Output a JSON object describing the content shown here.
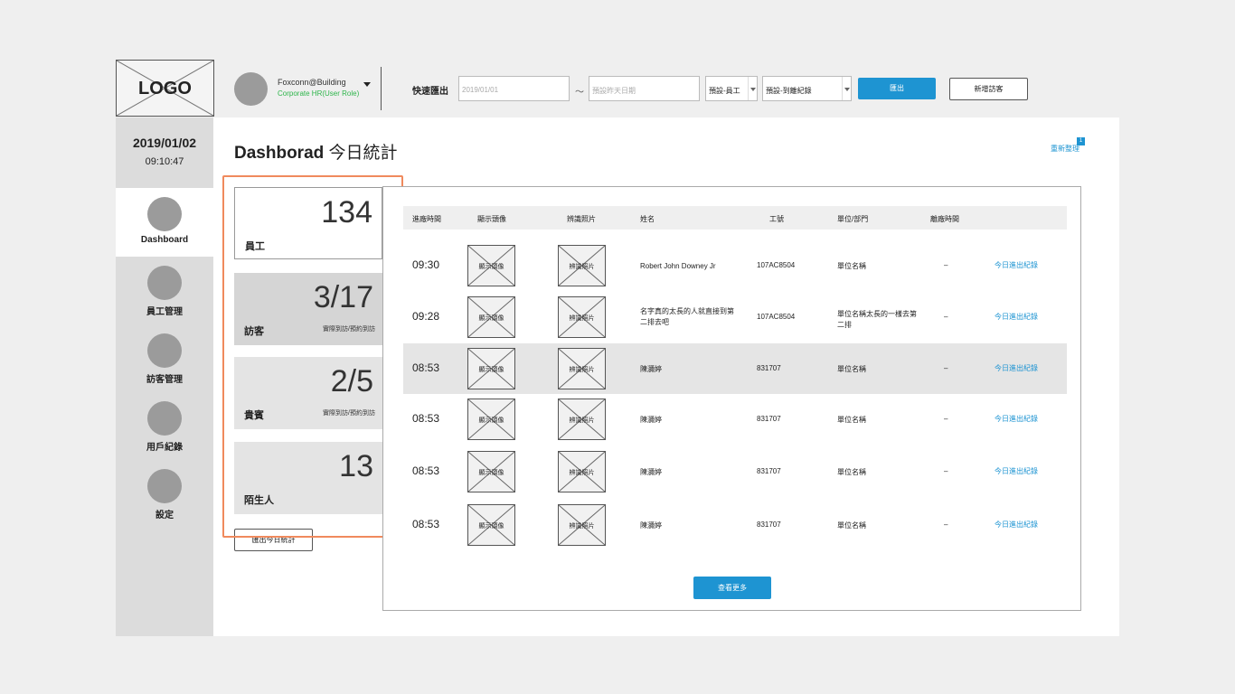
{
  "logo": {
    "text": "LOGO"
  },
  "user": {
    "name": "Foxconn@Building",
    "role": "Corporate HR(User Role)"
  },
  "quick_export": {
    "label": "快速匯出",
    "date_from": "2019/01/01",
    "separator": "～",
    "date_to_placeholder": "預設昨天日期",
    "type_select": "預設-員工",
    "record_select": "預設-到離紀錄",
    "export_button": "匯出"
  },
  "add_visitor_button": "新增訪客",
  "clock": {
    "date": "2019/01/02",
    "time": "09:10:47"
  },
  "sidebar": {
    "items": [
      {
        "label": "Dashboard",
        "active": true
      },
      {
        "label": "員工管理"
      },
      {
        "label": "訪客管理"
      },
      {
        "label": "用戶紀錄"
      },
      {
        "label": "設定"
      }
    ]
  },
  "page": {
    "title_en": "Dashborad",
    "title_zh": "今日統計",
    "refresh_link": "重新整理",
    "refresh_badge": "1"
  },
  "stats": {
    "staff": {
      "value": "134",
      "label": "員工"
    },
    "visitor": {
      "value": "3/17",
      "label": "訪客",
      "sub": "實際到訪/預約到訪"
    },
    "vip": {
      "value": "2/5",
      "label": "貴賓",
      "sub": "實際到訪/預約到訪"
    },
    "stranger": {
      "value": "13",
      "label": "陌生人"
    },
    "export_button": "匯出今日統計"
  },
  "table": {
    "headers": [
      "進廠時間",
      "顯示頭像",
      "辨識照片",
      "姓名",
      "工號",
      "單位/部門",
      "離廠時間"
    ],
    "photo_placeholder": "顯示頭像",
    "recog_placeholder": "辨識照片",
    "rows": [
      {
        "time": "09:30",
        "name": "Robert John Downey Jr",
        "emp_id": "107AC8504",
        "unit": "單位名稱",
        "leave": "–",
        "link": "今日進出紀錄"
      },
      {
        "time": "09:28",
        "name": "名字真的太長的人就直接到第二排去吧",
        "emp_id": "107AC8504",
        "unit": "單位名稱太長的一樣去第二排",
        "leave": "–",
        "link": "今日進出紀錄"
      },
      {
        "time": "08:53",
        "name": "陳瀰婷",
        "emp_id": "831707",
        "unit": "單位名稱",
        "leave": "–",
        "link": "今日進出紀錄",
        "highlight": true
      },
      {
        "time": "08:53",
        "name": "陳瀰婷",
        "emp_id": "831707",
        "unit": "單位名稱",
        "leave": "–",
        "link": "今日進出紀錄"
      },
      {
        "time": "08:53",
        "name": "陳瀰婷",
        "emp_id": "831707",
        "unit": "單位名稱",
        "leave": "–",
        "link": "今日進出紀錄"
      },
      {
        "time": "08:53",
        "name": "陳瀰婷",
        "emp_id": "831707",
        "unit": "單位名稱",
        "leave": "–",
        "link": "今日進出紀錄"
      }
    ],
    "more_button": "查看更多"
  },
  "colors": {
    "accent": "#1e94d2",
    "role_green": "#2db54a",
    "highlight_orange": "#f08a5d",
    "sidebar_bg": "#dcdcdc"
  }
}
